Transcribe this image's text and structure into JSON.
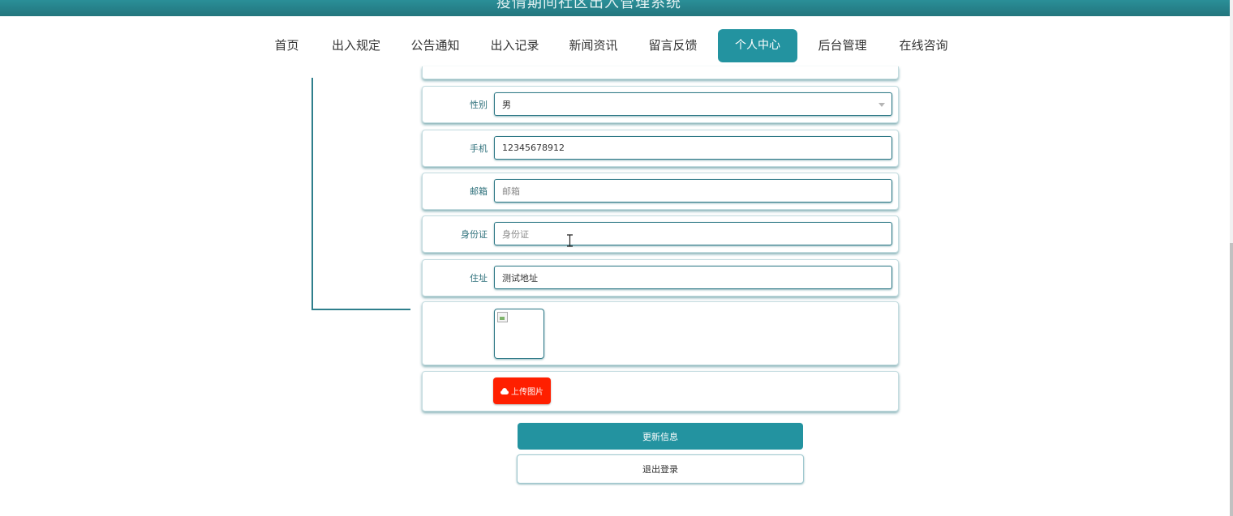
{
  "header": {
    "title": "疫情期间社区出入管理系统"
  },
  "nav": {
    "items": [
      {
        "label": "首页",
        "active": false
      },
      {
        "label": "出入规定",
        "active": false
      },
      {
        "label": "公告通知",
        "active": false
      },
      {
        "label": "出入记录",
        "active": false
      },
      {
        "label": "新闻资讯",
        "active": false
      },
      {
        "label": "留言反馈",
        "active": false
      },
      {
        "label": "个人中心",
        "active": true
      },
      {
        "label": "后台管理",
        "active": false
      },
      {
        "label": "在线咨询",
        "active": false
      }
    ]
  },
  "form": {
    "gender": {
      "label": "性别",
      "value": "男"
    },
    "phone": {
      "label": "手机",
      "value": "12345678912"
    },
    "email": {
      "label": "邮箱",
      "value": "",
      "placeholder": "邮箱"
    },
    "idcard": {
      "label": "身份证",
      "value": "",
      "placeholder": "身份证"
    },
    "address": {
      "label": "住址",
      "value": "测试地址"
    },
    "upload_label": "上传图片"
  },
  "actions": {
    "update_label": "更新信息",
    "logout_label": "退出登录"
  },
  "colors": {
    "accent": "#2393a0",
    "upload": "#ff1f00"
  }
}
